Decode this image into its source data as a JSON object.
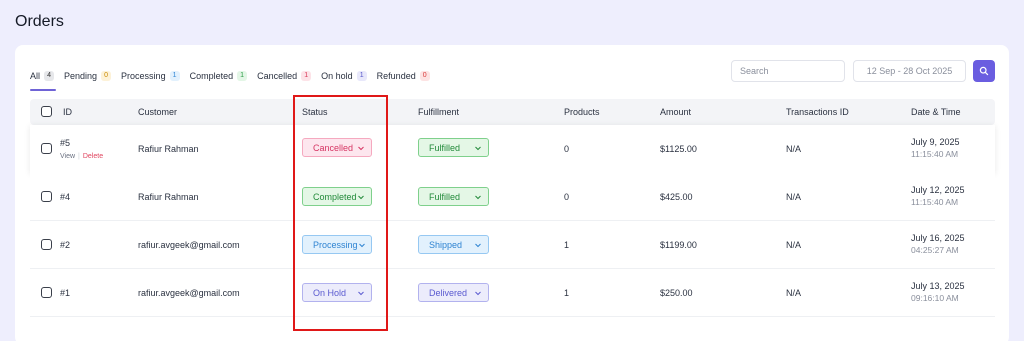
{
  "page": {
    "title": "Orders"
  },
  "tabs": [
    {
      "label": "All",
      "count": "4"
    },
    {
      "label": "Pending",
      "count": "0"
    },
    {
      "label": "Processing",
      "count": "1"
    },
    {
      "label": "Completed",
      "count": "1"
    },
    {
      "label": "Cancelled",
      "count": "1"
    },
    {
      "label": "On hold",
      "count": "1"
    },
    {
      "label": "Refunded",
      "count": "0"
    }
  ],
  "toolbar": {
    "search_placeholder": "Search",
    "date_range": "12 Sep - 28 Oct 2025",
    "search_button_icon": "search-icon"
  },
  "table": {
    "headers": {
      "id": "ID",
      "customer": "Customer",
      "status": "Status",
      "fulfillment": "Fulfillment",
      "products": "Products",
      "amount": "Amount",
      "transaction": "Transactions ID",
      "datetime": "Date & Time"
    },
    "row_actions": {
      "view": "View",
      "delete": "Delete"
    },
    "rows": [
      {
        "id": "#5",
        "customer": "Rafiur Rahman",
        "status": "Cancelled",
        "fulfillment": "Fulfilled",
        "products": "0",
        "amount": "$1125.00",
        "transaction": "N/A",
        "date": "July 9, 2025",
        "time": "11:15:40 AM"
      },
      {
        "id": "#4",
        "customer": "Rafiur Rahman",
        "status": "Completed",
        "fulfillment": "Fulfilled",
        "products": "0",
        "amount": "$425.00",
        "transaction": "N/A",
        "date": "July 12, 2025",
        "time": "11:15:40 AM"
      },
      {
        "id": "#2",
        "customer": "rafiur.avgeek@gmail.com",
        "status": "Processing",
        "fulfillment": "Shipped",
        "products": "1",
        "amount": "$1199.00",
        "transaction": "N/A",
        "date": "July 16, 2025",
        "time": "04:25:27 AM"
      },
      {
        "id": "#1",
        "customer": "rafiur.avgeek@gmail.com",
        "status": "On Hold",
        "fulfillment": "Delivered",
        "products": "1",
        "amount": "$250.00",
        "transaction": "N/A",
        "date": "July 13, 2025",
        "time": "09:16:10 AM"
      }
    ]
  },
  "colors": {
    "accent": "#6a5de0",
    "page_background": "#eeeefd",
    "highlight_box": "#e01818"
  }
}
